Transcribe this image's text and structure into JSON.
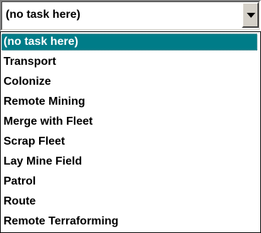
{
  "combo": {
    "selected_value": "(no task here)",
    "button_icon": "chevron-down-icon"
  },
  "list": {
    "items": [
      {
        "label": "(no task here)",
        "selected": true
      },
      {
        "label": "Transport",
        "selected": false
      },
      {
        "label": "Colonize",
        "selected": false
      },
      {
        "label": "Remote Mining",
        "selected": false
      },
      {
        "label": "Merge with Fleet",
        "selected": false
      },
      {
        "label": "Scrap Fleet",
        "selected": false
      },
      {
        "label": "Lay Mine Field",
        "selected": false
      },
      {
        "label": "Patrol",
        "selected": false
      },
      {
        "label": "Route",
        "selected": false
      },
      {
        "label": "Remote Terraforming",
        "selected": false
      }
    ]
  },
  "colors": {
    "selection_background": "#007c88",
    "selection_text": "#ffffff",
    "text": "#000000",
    "button_face": "#d4d0c8"
  }
}
